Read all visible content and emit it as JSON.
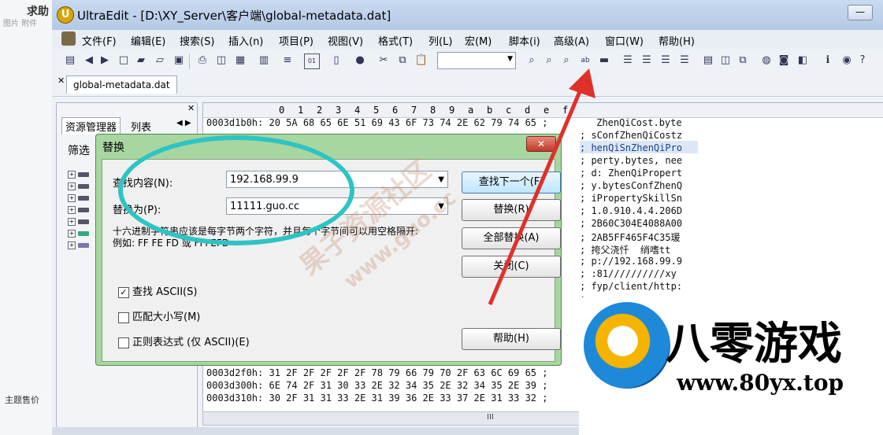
{
  "background_page": {
    "ask_label": "求助",
    "sub_labels": "图片    附件",
    "topic_label": "主题售价"
  },
  "window": {
    "title": "UltraEdit - [D:\\XY_Server\\客户端\\global-metadata.dat]",
    "app_icon": "ultraedit-logo-icon"
  },
  "menu": [
    "文件(F)",
    "编辑(E)",
    "搜索(S)",
    "插入(n)",
    "项目(P)",
    "视图(V)",
    "格式(T)",
    "列(L)",
    "宏(M)",
    "脚本(i)",
    "高级(A)",
    "窗口(W)",
    "帮助(H)"
  ],
  "toolbar_icons": [
    "page-setup-icon",
    "back-icon",
    "forward-icon",
    "new-file-icon",
    "open-folder-icon",
    "open-icon",
    "save-icon",
    "print-icon",
    "print-preview-icon",
    "chart-icon",
    "properties-icon",
    "wrap-icon",
    "hex-mode-icon",
    "document-icon",
    "browser-icon",
    "cut-icon",
    "copy-icon",
    "paste-icon",
    "find-icon",
    "find-next-icon",
    "find-prev-icon",
    "replace-icon",
    "print2-icon",
    "align-left-icon",
    "align-center-icon",
    "align-right-icon",
    "justify-icon",
    "window-h-icon",
    "window-v-icon",
    "cascade-icon",
    "globe-icon",
    "ftp-icon",
    "compare-icon",
    "help-icon",
    "context-help-icon",
    "question-icon"
  ],
  "file_tab": "global-metadata.dat",
  "left_panel": {
    "tab_explorer": "资源管理器",
    "tab_list": "列表",
    "filter_label": "筛选"
  },
  "hex": {
    "ruler": [
      "0",
      "1",
      "2",
      "3",
      "4",
      "5",
      "6",
      "7",
      "8",
      "9",
      "a",
      "b",
      "c",
      "d",
      "e",
      "f"
    ],
    "lines_top": [
      {
        "addr_hex": "0003d1b0h: 20 5A 68 65 6E 51 69 43 6F 73 74 2E 62 79 74 65 ;",
        "ascii": " ZhenQiCost.byte"
      }
    ],
    "ascii_right": [
      "; sConfZhenQiCostz",
      "; henQiSnZhenQiPro",
      "; perty.bytes, nee",
      "; d: ZhenQiPropert",
      "; y.bytesConfZhenQ",
      "; iPropertySkillSn",
      "; 1.0.910.4.4.206D",
      "; 2B60C304E4088A00",
      "; 2AB5FF465F4C35瑗",
      "; 挎父浇忏  绡嗜tt",
      "; p://192.168.99.9",
      "; :81//////////xy",
      "; fyp/client/http:",
      ";",
      ";"
    ],
    "lines_bottom": [
      "0003d2f0h: 31 2F 2F 2F 2F 2F 78 79 66 79 70 2F 63 6C 69 65 ;",
      "0003d300h: 6E 74 2F 31 30 33 2E 32 34 35 2E 32 34 35 2E 39 ;",
      "0003d310h: 30 2F 31 31 33 2E 31 39 36 2E 33 37 2E 31 33 32 ;"
    ],
    "scroll_grip": "III"
  },
  "dialog": {
    "title": "替换",
    "find_label": "查找内容(N):",
    "find_value": "192.168.99.9",
    "replace_label": "替换为(P):",
    "replace_value": "11111.guo.cc",
    "note_line1": "十六进制字符串应该是每字节两个字符，并且每个字节间可以用空格隔开:",
    "note_line2": "例如: FF FE FD 或 FFFEFD",
    "btn_find_next": "查找下一个(F)",
    "btn_replace": "替换(R)",
    "btn_replace_all": "全部替换(A)",
    "btn_close": "关闭(C)",
    "btn_help": "帮助(H)",
    "chk_ascii": "查找 ASCII(S)",
    "chk_ascii_checked": true,
    "chk_case": "匹配大小写(M)",
    "chk_regex": "正则表达式 (仅 ASCII)(E)"
  },
  "watermark": {
    "line1": "果子资源社区",
    "line2": "www.guo.cc"
  },
  "logo": {
    "name": "八零游戏",
    "url": "www.80yx.top"
  },
  "colors": {
    "annotation_ellipse": "#2ec4c4",
    "annotation_arrow": "#e0302a",
    "dialog_frame": "#a8d6a0",
    "selection": "#dbe7f6"
  }
}
